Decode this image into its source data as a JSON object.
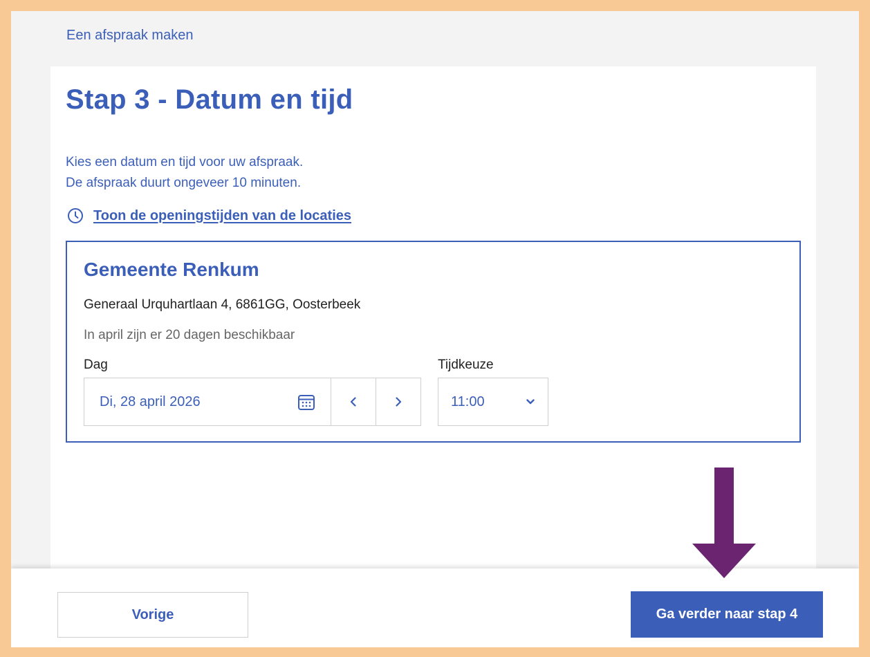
{
  "breadcrumb": "Een afspraak maken",
  "page_title": "Stap 3 - Datum en tijd",
  "intro": {
    "line1": "Kies een datum en tijd voor uw afspraak.",
    "line2": "De afspraak duurt ongeveer 10 minuten."
  },
  "hours_link": {
    "icon": "clock-icon",
    "label": "Toon de openingstijden van de locaties"
  },
  "location": {
    "name": "Gemeente Renkum",
    "address": "Generaal Urquhartlaan 4, 6861GG, Oosterbeek",
    "availability": "In april zijn er 20 dagen beschikbaar",
    "day_label": "Dag",
    "day_value": "Di, 28 april 2026",
    "day_icon": "calendar-icon",
    "prev_icon": "chevron-left-icon",
    "next_icon": "chevron-right-icon",
    "time_label": "Tijdkeuze",
    "time_value": "11:00",
    "time_icon": "chevron-down-icon"
  },
  "footer": {
    "prev_label": "Vorige",
    "next_label": "Ga verder naar stap 4"
  },
  "colors": {
    "accent": "#3b5fb8",
    "highlight_border": "#f8c994",
    "annotation_arrow": "#6b2470"
  }
}
